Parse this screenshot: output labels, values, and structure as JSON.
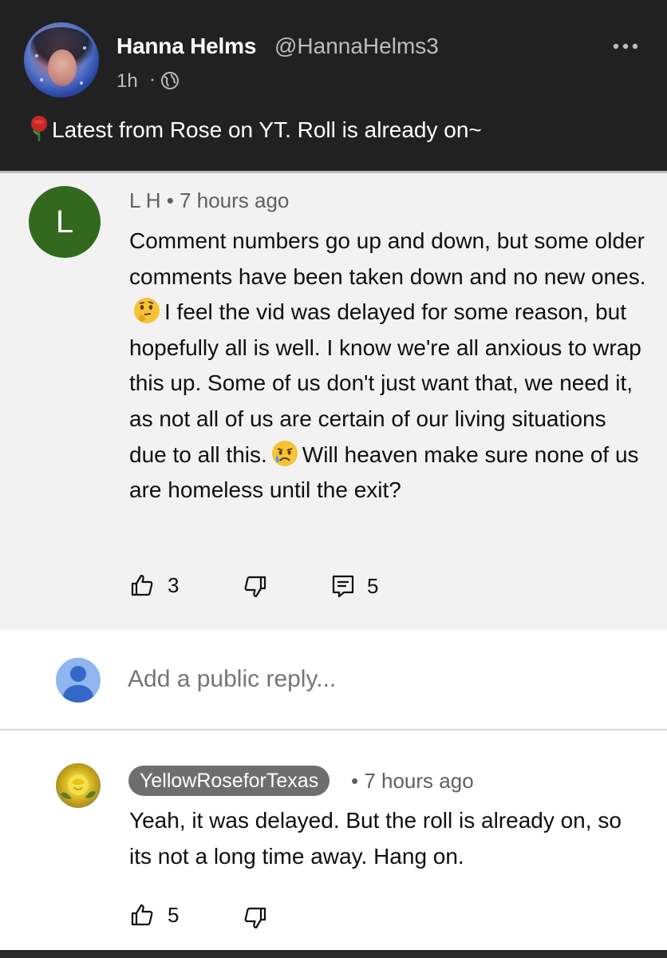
{
  "post": {
    "author_name": "Hanna Helms",
    "author_handle": "@HannaHelms3",
    "time": "1h",
    "separator": "·",
    "text": "Latest from Rose on YT. Roll is already on~",
    "icons": {
      "avatar": "avatar-photo",
      "visibility": "globe-icon",
      "menu": "more-vertical-icon",
      "text_emoji": "rose-icon"
    }
  },
  "comment": {
    "avatar_letter": "L",
    "avatar_color": "#33691e",
    "meta": "L H • 7 hours ago",
    "body_part1": "Comment numbers go up and down, but some older comments have been taken down and no new ones.",
    "body_part2": "I feel the vid was delayed for some reason, but hopefully all is well. I know we're all anxious to wrap this up. Some of us don't just want that, we need it, as not all of us are certain of our living situations due to all this.",
    "body_part3": "Will heaven make sure none of us are homeless until the exit?",
    "emojis": [
      "thinking-face-emoji",
      "sad-but-relieved-face-emoji"
    ],
    "likes": "3",
    "replies": "5",
    "background": "#f2f2f2"
  },
  "reply_box": {
    "placeholder": "Add a public reply..."
  },
  "reply": {
    "author": "YellowRoseforTexas",
    "time": "• 7 hours ago",
    "body": "Yeah, it was delayed. But the roll is already on, so its not a long time away. Hang on.",
    "likes": "5",
    "author_chip_color": "#6e6e6e"
  }
}
